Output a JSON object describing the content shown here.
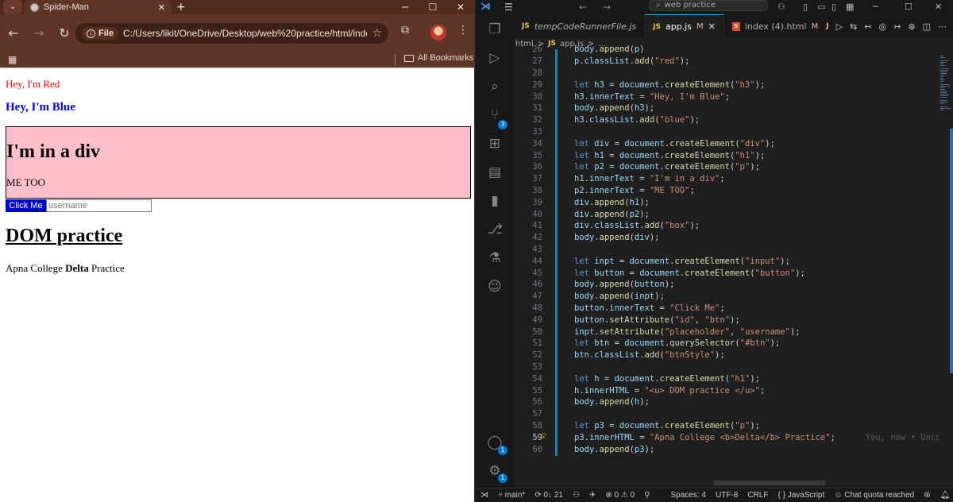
{
  "browser": {
    "tab_title": "Spider-Man",
    "tab_close": "✕",
    "new_tab": "+",
    "window_controls": [
      "─",
      "☐",
      "✕"
    ],
    "nav": {
      "back": "←",
      "forward": "→",
      "reload": "↻"
    },
    "omnibox": {
      "scheme_label": "File",
      "url": "C:/Users/likit/OneDrive/Desktop/web%20practice/html/index...",
      "star": "☆"
    },
    "bookmarks": {
      "folder_label": "All Bookmarks"
    },
    "page": {
      "red_text": "Hey, I'm Red",
      "blue_text": "Hey, I'm Blue",
      "div_heading": "I'm in a div",
      "div_paragraph": "ME TOO",
      "button_label": "Click Me",
      "input_placeholder": "username",
      "h1_text": "DOM practice",
      "p3_prefix": "Apna College ",
      "p3_bold": "Delta",
      "p3_suffix": " Practice"
    }
  },
  "vscode": {
    "search_text": "web practice",
    "tabs": [
      {
        "label": "tempCodeRunnerFile.js",
        "badge": "JS",
        "italic": true,
        "modified": "",
        "active": false
      },
      {
        "label": "app.js",
        "badge": "JS",
        "italic": false,
        "modified": "M",
        "active": true
      },
      {
        "label": "index (4).html",
        "badge": "5",
        "italic": false,
        "modified": "M",
        "active": false
      }
    ],
    "breadcrumbs": [
      "html",
      ">",
      "JS",
      "app.js",
      ">",
      "..."
    ],
    "status": {
      "branch": "main*",
      "sync": "0↓ 21",
      "errors": "⊗ 0 ⚠ 0",
      "spaces": "Spaces: 4",
      "encoding": "UTF-8",
      "eol": "CRLF",
      "language": "JavaScript",
      "copilot": "Chat quota reached"
    },
    "badges": {
      "scm": "3",
      "accounts": "1",
      "settings": "1"
    },
    "ghost_text": "You, now • Uncom",
    "lines": [
      {
        "n": "26",
        "text": "body.append(p)"
      },
      {
        "n": "27",
        "text": "p.classList.add(\"red\");"
      },
      {
        "n": "28",
        "text": ""
      },
      {
        "n": "29",
        "text": "let h3 = document.createElement(\"h3\");"
      },
      {
        "n": "30",
        "text": "h3.innerText = \"Hey, I'm Blue\";"
      },
      {
        "n": "31",
        "text": "body.append(h3);"
      },
      {
        "n": "32",
        "text": "h3.classList.add(\"blue\");"
      },
      {
        "n": "33",
        "text": ""
      },
      {
        "n": "34",
        "text": "let div = document.createElement(\"div\");"
      },
      {
        "n": "35",
        "text": "let h1 = document.createElement(\"h1\");"
      },
      {
        "n": "36",
        "text": "let p2 = document.createElement(\"p\");"
      },
      {
        "n": "37",
        "text": "h1.innerText = \"I'm in a div\";"
      },
      {
        "n": "38",
        "text": "p2.innerText = \"ME TOO\";"
      },
      {
        "n": "39",
        "text": "div.append(h1);"
      },
      {
        "n": "40",
        "text": "div.append(p2);"
      },
      {
        "n": "41",
        "text": "div.classList.add(\"box\");"
      },
      {
        "n": "42",
        "text": "body.append(div);"
      },
      {
        "n": "43",
        "text": ""
      },
      {
        "n": "44",
        "text": "let inpt = document.createElement(\"input\");"
      },
      {
        "n": "45",
        "text": "let button = document.createElement(\"button\");"
      },
      {
        "n": "46",
        "text": "body.append(button);"
      },
      {
        "n": "47",
        "text": "body.append(inpt);"
      },
      {
        "n": "48",
        "text": "button.innerText = \"Click Me\";"
      },
      {
        "n": "49",
        "text": "button.setAttribute(\"id\", \"btn\");"
      },
      {
        "n": "50",
        "text": "inpt.setAttribute(\"placeholder\", \"username\");"
      },
      {
        "n": "51",
        "text": "let btn = document.querySelector(\"#btn\");"
      },
      {
        "n": "52",
        "text": "btn.classList.add(\"btnStyle\");"
      },
      {
        "n": "53",
        "text": ""
      },
      {
        "n": "54",
        "text": "let h = document.createElement(\"h1\");"
      },
      {
        "n": "55",
        "text": "h.innerHTML = \"<u> DOM practice </u>\";"
      },
      {
        "n": "56",
        "text": "body.append(h);"
      },
      {
        "n": "57",
        "text": ""
      },
      {
        "n": "58",
        "text": "let p3 = document.createElement(\"p\");"
      },
      {
        "n": "59",
        "text": "p3.innerHTML = \"Apna College <b>Delta</b> Practice\";"
      },
      {
        "n": "60",
        "text": "body.append(p3);"
      }
    ],
    "current_line": "59",
    "colors": {
      "accent": "#3ea6ff",
      "keyword": "#569cd6",
      "variable": "#9cdcfe",
      "string": "#ce9178",
      "function": "#dcdcaa"
    }
  }
}
